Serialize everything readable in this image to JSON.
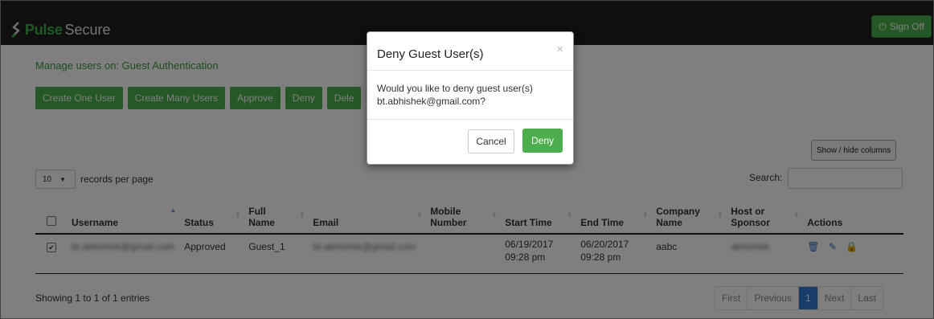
{
  "app": {
    "logo_pulse": "Pulse",
    "logo_secure": "Secure",
    "sign_out": "Sign Off"
  },
  "page": {
    "manage_text": "Manage users on: Guest Authentication"
  },
  "toolbar": {
    "buttons": [
      "Create One User",
      "Create Many Users",
      "Approve",
      "Deny",
      "Dele"
    ]
  },
  "show_hide": "Show / hide columns",
  "records": {
    "value": "10",
    "label": "records per page"
  },
  "search": {
    "label": "Search:",
    "value": ""
  },
  "table": {
    "headers": [
      "",
      "Username",
      "Status",
      "Full\nName",
      "Email",
      "Mobile\nNumber",
      "Start Time",
      "End Time",
      "Company\nName",
      "Host or\nSponsor",
      "Actions"
    ],
    "rows": [
      {
        "checked": true,
        "username": "bt.abhishek@gmail.com",
        "status": "Approved",
        "full_name": "Guest_1",
        "email": "bt.abhishek@gmail.com",
        "mobile": "",
        "start": "06/19/2017\n09:28 pm",
        "end": "06/20/2017\n09:28 pm",
        "company": "aabc",
        "host": "abhishek"
      }
    ]
  },
  "footer": {
    "showing": "Showing 1 to 1 of 1 entries",
    "pager": [
      "First",
      "Previous",
      "1",
      "Next",
      "Last"
    ]
  },
  "modal": {
    "title": "Deny Guest User(s)",
    "close": "×",
    "body": "Would you like to deny guest user(s) bt.abhishek@gmail.com?",
    "cancel": "Cancel",
    "deny": "Deny"
  },
  "colors": {
    "brand_green": "#4cae4c",
    "header_bg": "#1f1f1f",
    "link_blue": "#2f70c0"
  }
}
